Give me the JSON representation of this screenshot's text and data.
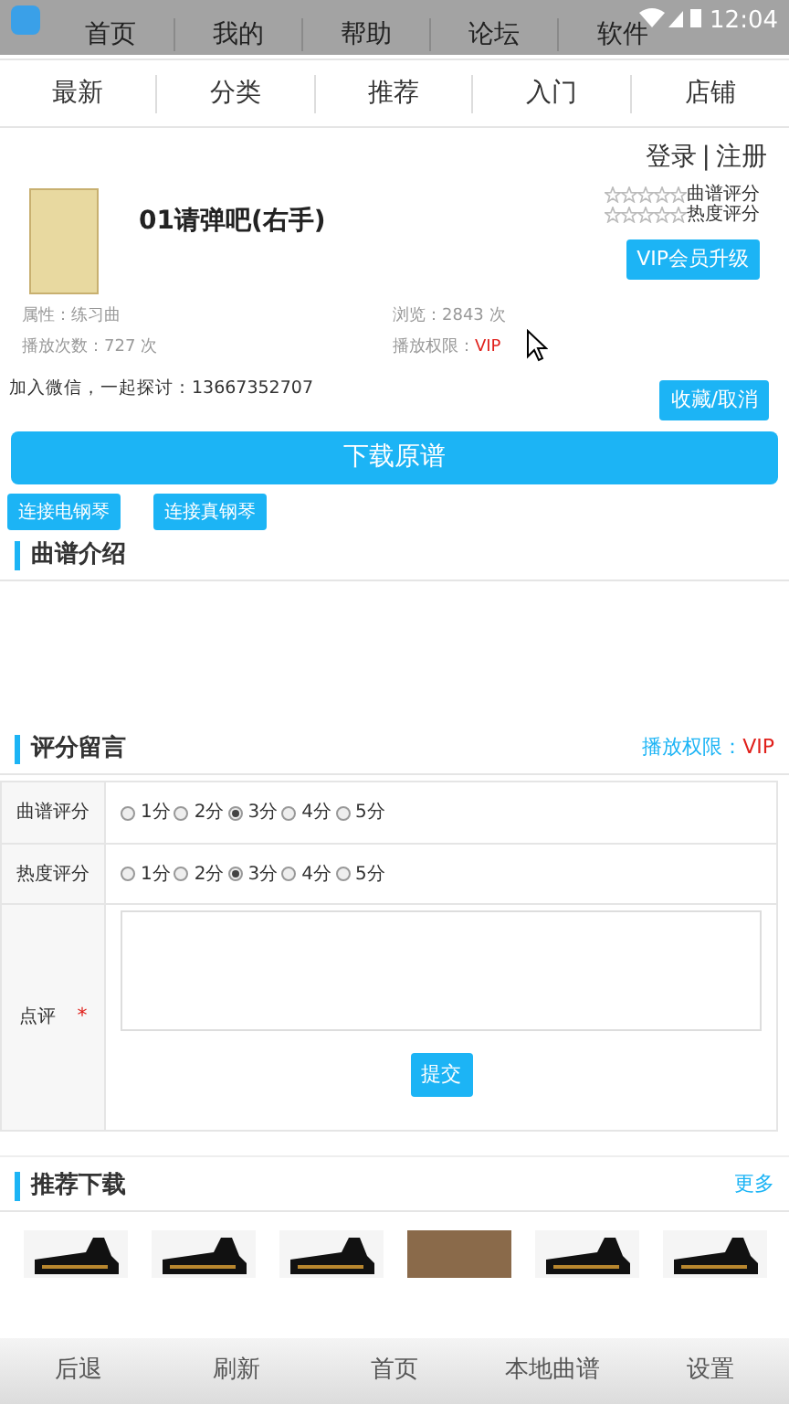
{
  "status_bar": {
    "time": "12:04"
  },
  "top_nav": [
    {
      "label": "首页"
    },
    {
      "label": "我的"
    },
    {
      "label": "帮助"
    },
    {
      "label": "论坛"
    },
    {
      "label": "软件"
    }
  ],
  "sub_nav": [
    {
      "label": "最新"
    },
    {
      "label": "分类"
    },
    {
      "label": "推荐"
    },
    {
      "label": "入门"
    },
    {
      "label": "店铺"
    }
  ],
  "account": {
    "login": "登录",
    "separator": "|",
    "register": "注册"
  },
  "song": {
    "title": "01请弹吧(右手)",
    "ratings": [
      {
        "label": "曲谱评分",
        "stars": 0
      },
      {
        "label": "热度评分",
        "stars": 0
      }
    ],
    "vip_button": "VIP会员升级",
    "attributes": [
      {
        "label": "属性：",
        "value": "练习曲",
        "highlight": false
      },
      {
        "label": "浏览：",
        "value": "2843 次",
        "highlight": false
      },
      {
        "label": "播放次数：",
        "value": "727 次",
        "highlight": false
      },
      {
        "label": "播放权限：",
        "value": "VIP",
        "highlight": true
      }
    ],
    "wechat": "加入微信，一起探讨：13667352707",
    "favorite_button": "收藏/取消",
    "download_button": "下载原谱",
    "connect_buttons": [
      "连接电钢琴",
      "连接真钢琴"
    ]
  },
  "intro": {
    "title": "曲谱介绍"
  },
  "comments": {
    "title": "评分留言",
    "permission_label": "播放权限：",
    "permission_value": "VIP",
    "rows": [
      {
        "kind": "radio",
        "label": "曲谱评分",
        "options": [
          {
            "label": "1分",
            "selected": false
          },
          {
            "label": "2分",
            "selected": false
          },
          {
            "label": "3分",
            "selected": true
          },
          {
            "label": "4分",
            "selected": false
          },
          {
            "label": "5分",
            "selected": false
          }
        ]
      },
      {
        "kind": "radio",
        "label": "热度评分",
        "options": [
          {
            "label": "1分",
            "selected": false
          },
          {
            "label": "2分",
            "selected": false
          },
          {
            "label": "3分",
            "selected": true
          },
          {
            "label": "4分",
            "selected": false
          },
          {
            "label": "5分",
            "selected": false
          }
        ]
      },
      {
        "kind": "textarea",
        "label": "点评",
        "required": true,
        "required_mark": "*"
      }
    ],
    "submit_button": "提交"
  },
  "recommended": {
    "title": "推荐下载",
    "more": "更多",
    "thumbnails": [
      {
        "kind": "piano"
      },
      {
        "kind": "piano"
      },
      {
        "kind": "piano"
      },
      {
        "kind": "photo"
      },
      {
        "kind": "piano"
      },
      {
        "kind": "piano"
      }
    ]
  },
  "bottom_nav": [
    {
      "label": "后退"
    },
    {
      "label": "刷新"
    },
    {
      "label": "首页"
    },
    {
      "label": "本地曲谱"
    },
    {
      "label": "设置"
    }
  ]
}
